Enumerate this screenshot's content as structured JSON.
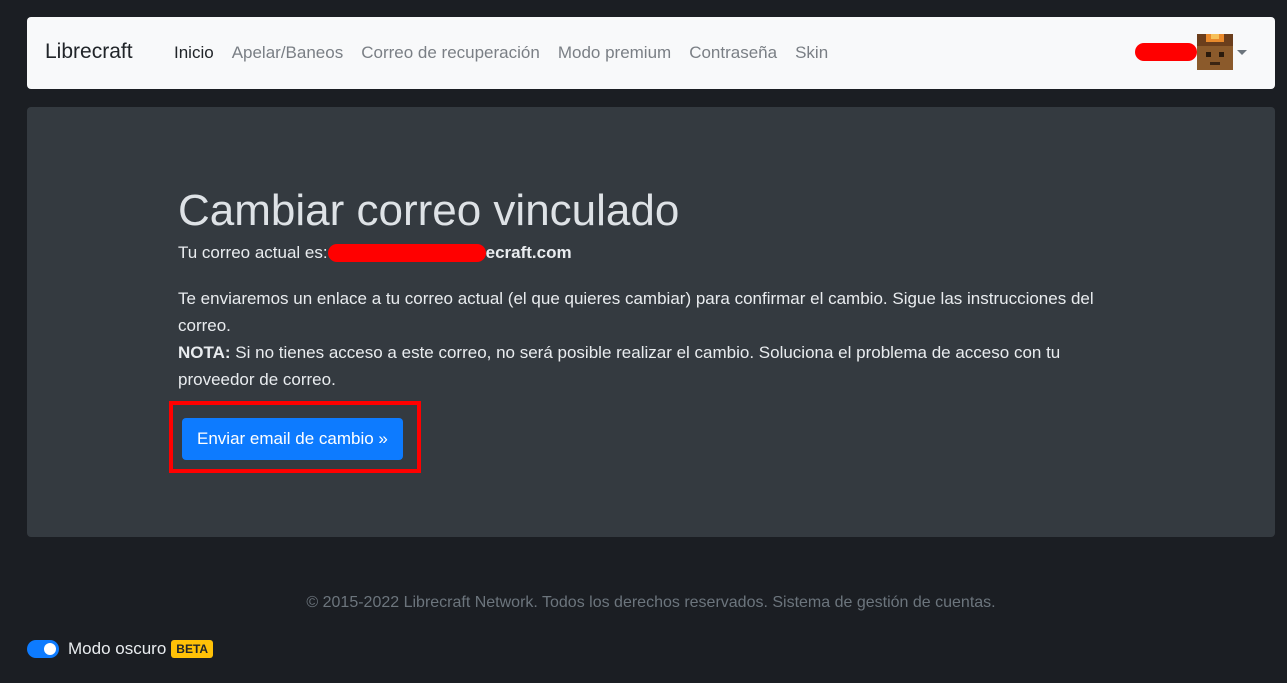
{
  "navbar": {
    "brand": "Librecraft",
    "links": [
      {
        "label": "Inicio",
        "active": true
      },
      {
        "label": "Apelar/Baneos",
        "active": false
      },
      {
        "label": "Correo de recuperación",
        "active": false
      },
      {
        "label": "Modo premium",
        "active": false
      },
      {
        "label": "Contraseña",
        "active": false
      },
      {
        "label": "Skin",
        "active": false
      }
    ]
  },
  "main": {
    "title": "Cambiar correo vinculado",
    "current_email_label": "Tu correo actual es:",
    "current_email_suffix": "ecraft.com",
    "description": "Te enviaremos un enlace a tu correo actual (el que quieres cambiar) para confirmar el cambio. Sigue las instrucciones del correo.",
    "note_label": "NOTA:",
    "note_text": " Si no tienes acceso a este correo, no será posible realizar el cambio. Soluciona el problema de acceso con tu proveedor de correo.",
    "send_button": "Enviar email de cambio »"
  },
  "footer": {
    "text": "© 2015-2022 Librecraft Network. Todos los derechos reservados. Sistema de gestión de cuentas."
  },
  "dark_mode": {
    "label": "Modo oscuro",
    "badge": "BETA",
    "enabled": true
  },
  "colors": {
    "page_bg": "#1b1e23",
    "navbar_bg": "#f8f9fa",
    "panel_bg": "#343a40",
    "primary": "#0d7bff",
    "highlight": "#ff0000",
    "badge": "#ffc107"
  }
}
